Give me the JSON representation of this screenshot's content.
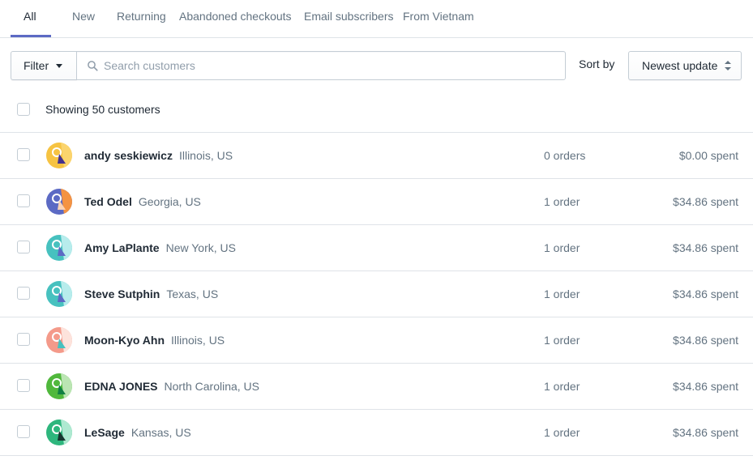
{
  "tabs": [
    {
      "label": "All",
      "active": true
    },
    {
      "label": "New"
    },
    {
      "label": "Returning"
    },
    {
      "label": "Abandoned checkouts"
    },
    {
      "label": "Email subscribers"
    },
    {
      "label": "From Vietnam"
    }
  ],
  "toolbar": {
    "filter_label": "Filter",
    "search_placeholder": "Search customers",
    "search_value": "",
    "sort_label": "Sort by",
    "sort_value": "Newest update"
  },
  "summary": {
    "showing_text": "Showing 50 customers"
  },
  "customers": [
    {
      "name": "andy seskiewicz",
      "location": "Illinois, US",
      "orders": "0 orders",
      "spent": "$0.00 spent",
      "avatar_icon": "avatar-yellow-icon",
      "avatar_colors": [
        "#f6c342",
        "#fbd46d",
        "#44318d"
      ]
    },
    {
      "name": "Ted Odel",
      "location": "Georgia, US",
      "orders": "1 order",
      "spent": "$34.86 spent",
      "avatar_icon": "avatar-indigo-icon",
      "avatar_colors": [
        "#5c6ac4",
        "#f49342",
        "#fbd3b5"
      ]
    },
    {
      "name": "Amy LaPlante",
      "location": "New York, US",
      "orders": "1 order",
      "spent": "$34.86 spent",
      "avatar_icon": "avatar-teal-icon",
      "avatar_colors": [
        "#47c1bf",
        "#b7ecec",
        "#5c6ac4"
      ]
    },
    {
      "name": "Steve Sutphin",
      "location": "Texas, US",
      "orders": "1 order",
      "spent": "$34.86 spent",
      "avatar_icon": "avatar-teal-icon",
      "avatar_colors": [
        "#47c1bf",
        "#b7ecec",
        "#5c6ac4"
      ]
    },
    {
      "name": "Moon-Kyo Ahn",
      "location": "Illinois, US",
      "orders": "1 order",
      "spent": "$34.86 spent",
      "avatar_icon": "avatar-salmon-icon",
      "avatar_colors": [
        "#f49a8a",
        "#fde3dc",
        "#47c1bf"
      ]
    },
    {
      "name": "EDNA JONES",
      "location": "North Carolina, US",
      "orders": "1 order",
      "spent": "$34.86 spent",
      "avatar_icon": "avatar-green-icon",
      "avatar_colors": [
        "#50b83c",
        "#bbe5b3",
        "#108043"
      ]
    },
    {
      "name": "LeSage",
      "location": "Kansas, US",
      "orders": "1 order",
      "spent": "$34.86 spent",
      "avatar_icon": "avatar-green-icon",
      "avatar_colors": [
        "#2eb67d",
        "#aee9d1",
        "#173630"
      ]
    }
  ]
}
